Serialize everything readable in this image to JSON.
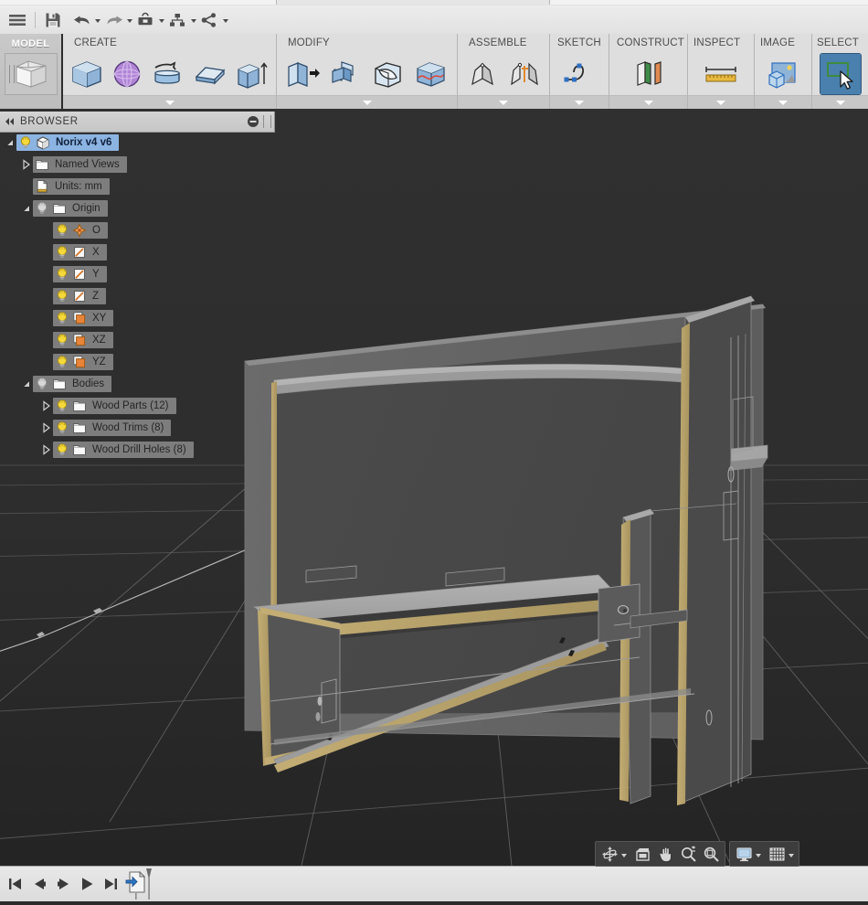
{
  "app": {
    "title": "Fusion 360 CAD",
    "document_name": "Norix v4 v6"
  },
  "quick_access": {
    "items": [
      {
        "name": "app-menu-button",
        "icon": "hamburger-icon",
        "label": "Show Menu",
        "dropdown": false
      },
      {
        "name": "save-button",
        "icon": "save-icon",
        "label": "Save",
        "dropdown": false
      },
      {
        "name": "undo-button",
        "icon": "undo-icon",
        "label": "Undo",
        "dropdown": true
      },
      {
        "name": "redo-button",
        "icon": "redo-icon",
        "label": "Redo",
        "dropdown": true
      },
      {
        "name": "tools-button",
        "icon": "toolbox-icon",
        "label": "Tools",
        "dropdown": true
      },
      {
        "name": "assembly-button",
        "icon": "hierarchy-icon",
        "label": "Assembly",
        "dropdown": true
      },
      {
        "name": "share-button",
        "icon": "share-icon",
        "label": "Share",
        "dropdown": true
      }
    ]
  },
  "ribbon": {
    "workspace_label": "MODEL",
    "workspace_icon": "cube-icon",
    "panels": [
      {
        "title": "CREATE",
        "name": "panel-create",
        "tools": [
          {
            "name": "tool-box",
            "icon": "box-icon",
            "label": "Box"
          },
          {
            "name": "tool-sphere",
            "icon": "sphere-icon",
            "label": "Sphere"
          },
          {
            "name": "tool-revolve",
            "icon": "revolve-icon",
            "label": "Revolve"
          },
          {
            "name": "tool-loft",
            "icon": "loft-icon",
            "label": "Loft"
          },
          {
            "name": "tool-extrude",
            "icon": "extrude-icon",
            "label": "Extrude"
          }
        ]
      },
      {
        "title": "MODIFY",
        "name": "panel-modify",
        "tools": [
          {
            "name": "tool-press-pull",
            "icon": "press-pull-icon",
            "label": "Press Pull"
          },
          {
            "name": "tool-combine",
            "icon": "combine-icon",
            "label": "Combine"
          },
          {
            "name": "tool-shell",
            "icon": "shell-icon",
            "label": "Shell"
          },
          {
            "name": "tool-split-face",
            "icon": "split-face-icon",
            "label": "Split Face"
          }
        ]
      },
      {
        "title": "ASSEMBLE",
        "name": "panel-assemble",
        "tools": [
          {
            "name": "tool-new-component",
            "icon": "component-icon",
            "label": "New Component"
          },
          {
            "name": "tool-joint",
            "icon": "joint-icon",
            "label": "Joint"
          }
        ]
      },
      {
        "title": "SKETCH",
        "name": "panel-sketch",
        "tools": [
          {
            "name": "tool-create-sketch",
            "icon": "spline-icon",
            "label": "Create Sketch"
          }
        ]
      },
      {
        "title": "CONSTRUCT",
        "name": "panel-construct",
        "tools": [
          {
            "name": "tool-offset-plane",
            "icon": "plane-icon",
            "label": "Offset Plane"
          }
        ]
      },
      {
        "title": "INSPECT",
        "name": "panel-inspect",
        "tools": [
          {
            "name": "tool-measure",
            "icon": "ruler-icon",
            "label": "Measure"
          }
        ]
      },
      {
        "title": "IMAGE",
        "name": "panel-image",
        "tools": [
          {
            "name": "tool-canvas",
            "icon": "picture-icon",
            "label": "Canvas"
          }
        ]
      },
      {
        "title": "SELECT",
        "name": "panel-select",
        "tools": [
          {
            "name": "tool-select",
            "icon": "select-arrow-icon",
            "label": "Select",
            "selected": true
          }
        ]
      }
    ]
  },
  "browser": {
    "header_title": "BROWSER",
    "collapse_icon": "double-chevron-left-icon",
    "minimize_icon": "minimize-circle-icon",
    "tree": [
      {
        "name": "tree-item-document",
        "label": "Norix v4 v6",
        "indent": 0,
        "arrow": "expanded",
        "bulb": true,
        "icon": "component-cube-icon",
        "selected": true
      },
      {
        "name": "tree-item-named-views",
        "label": "Named Views",
        "indent": 1,
        "arrow": "collapsed",
        "bulb": false,
        "icon": "folder-icon",
        "selected": false
      },
      {
        "name": "tree-item-units",
        "label": "Units: mm",
        "indent": 1,
        "arrow": "none",
        "bulb": false,
        "icon": "units-doc-icon",
        "selected": false
      },
      {
        "name": "tree-item-origin",
        "label": "Origin",
        "indent": 1,
        "arrow": "expanded",
        "bulb": true,
        "bulb_off": true,
        "icon": "folder-icon",
        "selected": false
      },
      {
        "name": "tree-item-origin-point",
        "label": "O",
        "indent": 2,
        "arrow": "none",
        "bulb": true,
        "icon": "origin-point-icon",
        "selected": false
      },
      {
        "name": "tree-item-axis-x",
        "label": "X",
        "indent": 2,
        "arrow": "none",
        "bulb": true,
        "icon": "axis-icon",
        "selected": false
      },
      {
        "name": "tree-item-axis-y",
        "label": "Y",
        "indent": 2,
        "arrow": "none",
        "bulb": true,
        "icon": "axis-icon",
        "selected": false
      },
      {
        "name": "tree-item-axis-z",
        "label": "Z",
        "indent": 2,
        "arrow": "none",
        "bulb": true,
        "icon": "axis-icon",
        "selected": false
      },
      {
        "name": "tree-item-plane-xy",
        "label": "XY",
        "indent": 2,
        "arrow": "none",
        "bulb": true,
        "icon": "plane-icon",
        "selected": false
      },
      {
        "name": "tree-item-plane-xz",
        "label": "XZ",
        "indent": 2,
        "arrow": "none",
        "bulb": true,
        "icon": "plane-icon",
        "selected": false
      },
      {
        "name": "tree-item-plane-yz",
        "label": "YZ",
        "indent": 2,
        "arrow": "none",
        "bulb": true,
        "icon": "plane-icon",
        "selected": false
      },
      {
        "name": "tree-item-bodies",
        "label": "Bodies",
        "indent": 1,
        "arrow": "expanded",
        "bulb": true,
        "bulb_off": true,
        "icon": "folder-icon",
        "selected": false
      },
      {
        "name": "tree-item-wood-parts",
        "label": "Wood Parts (12)",
        "indent": 2,
        "arrow": "collapsed",
        "bulb": true,
        "icon": "folder-icon",
        "selected": false
      },
      {
        "name": "tree-item-wood-trims",
        "label": "Wood Trims (8)",
        "indent": 2,
        "arrow": "collapsed",
        "bulb": true,
        "icon": "folder-icon",
        "selected": false
      },
      {
        "name": "tree-item-wood-drill-holes",
        "label": "Wood Drill Holes (8)",
        "indent": 2,
        "arrow": "collapsed",
        "bulb": true,
        "icon": "folder-icon",
        "selected": false
      }
    ]
  },
  "viewport": {
    "background_top": "#2e2e2e",
    "background_bottom": "#262626",
    "grid_line_color": "#6e6e6e",
    "model_name": "Norix v4 v6",
    "material_wood_edge": "#b5a06a",
    "material_panel_face": "#6e6e6e",
    "material_panel_dark": "#3d3d3d",
    "material_metal_top": "#a9a9a9"
  },
  "nav_bar": {
    "groups": [
      {
        "name": "navigation-group",
        "buttons": [
          {
            "name": "orbit-button",
            "icon": "orbit-icon",
            "label": "Orbit",
            "dropdown": true
          },
          {
            "name": "look-at-button",
            "icon": "look-at-icon",
            "label": "Look At",
            "dropdown": false
          },
          {
            "name": "pan-button",
            "icon": "pan-hand-icon",
            "label": "Pan",
            "dropdown": false
          },
          {
            "name": "zoom-button",
            "icon": "zoom-icon",
            "label": "Zoom",
            "dropdown": false
          },
          {
            "name": "fit-button",
            "icon": "fit-icon",
            "label": "Fit",
            "dropdown": false
          }
        ]
      },
      {
        "name": "display-group",
        "buttons": [
          {
            "name": "display-settings-button",
            "icon": "monitor-icon",
            "label": "Display Settings",
            "dropdown": true
          },
          {
            "name": "grid-snaps-button",
            "icon": "grid-icon",
            "label": "Grid and Snaps",
            "dropdown": true
          }
        ]
      }
    ]
  },
  "timeline": {
    "buttons": [
      {
        "name": "timeline-go-to-beginning",
        "icon": "skip-back-icon",
        "label": "Go to beginning"
      },
      {
        "name": "timeline-step-back",
        "icon": "step-back-icon",
        "label": "Step back"
      },
      {
        "name": "timeline-step-forward",
        "icon": "step-forward-icon",
        "label": "Step forward"
      },
      {
        "name": "timeline-play",
        "icon": "play-icon",
        "label": "Play"
      },
      {
        "name": "timeline-go-to-end",
        "icon": "skip-forward-icon",
        "label": "Go to end"
      }
    ],
    "feature_marker": {
      "name": "timeline-feature-import",
      "icon": "import-document-icon",
      "label": "Import"
    }
  }
}
